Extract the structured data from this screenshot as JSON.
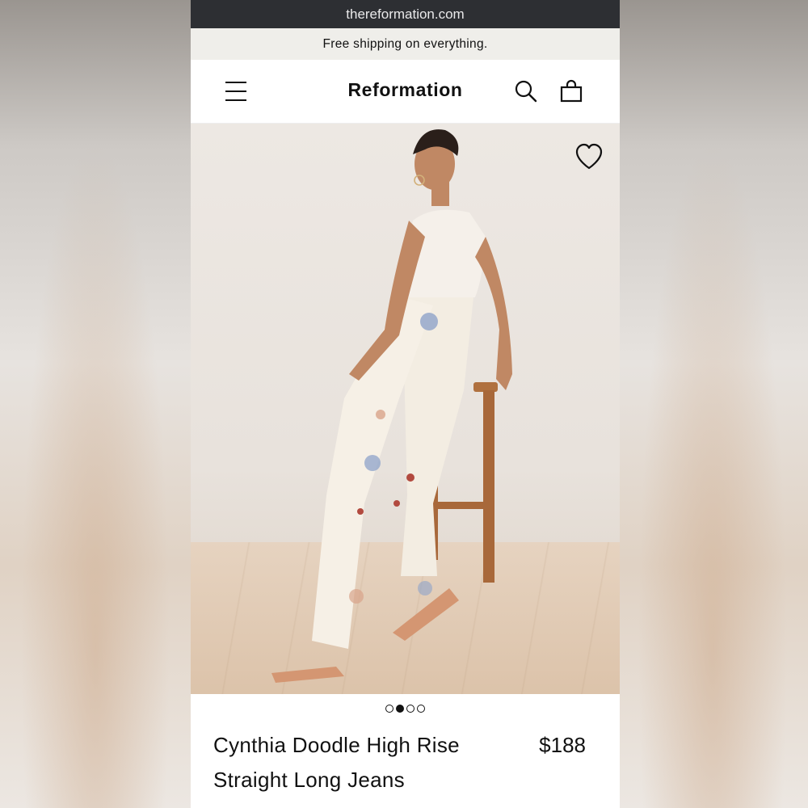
{
  "browser": {
    "url": "thereformation.com"
  },
  "promo": {
    "text": "Free shipping on everything."
  },
  "header": {
    "brand": "Reformation",
    "icons": [
      "menu-icon",
      "search-icon",
      "shopping-bag-icon"
    ]
  },
  "gallery": {
    "image_count": 4,
    "active_index": 1,
    "wishlist_icon": "heart-icon"
  },
  "product": {
    "name": "Cynthia Doodle High Rise Straight Long Jeans",
    "price": "$188"
  },
  "colors": {
    "url_bar": "#2d2f33",
    "promo_bg": "#efeeea",
    "text": "#111111"
  }
}
